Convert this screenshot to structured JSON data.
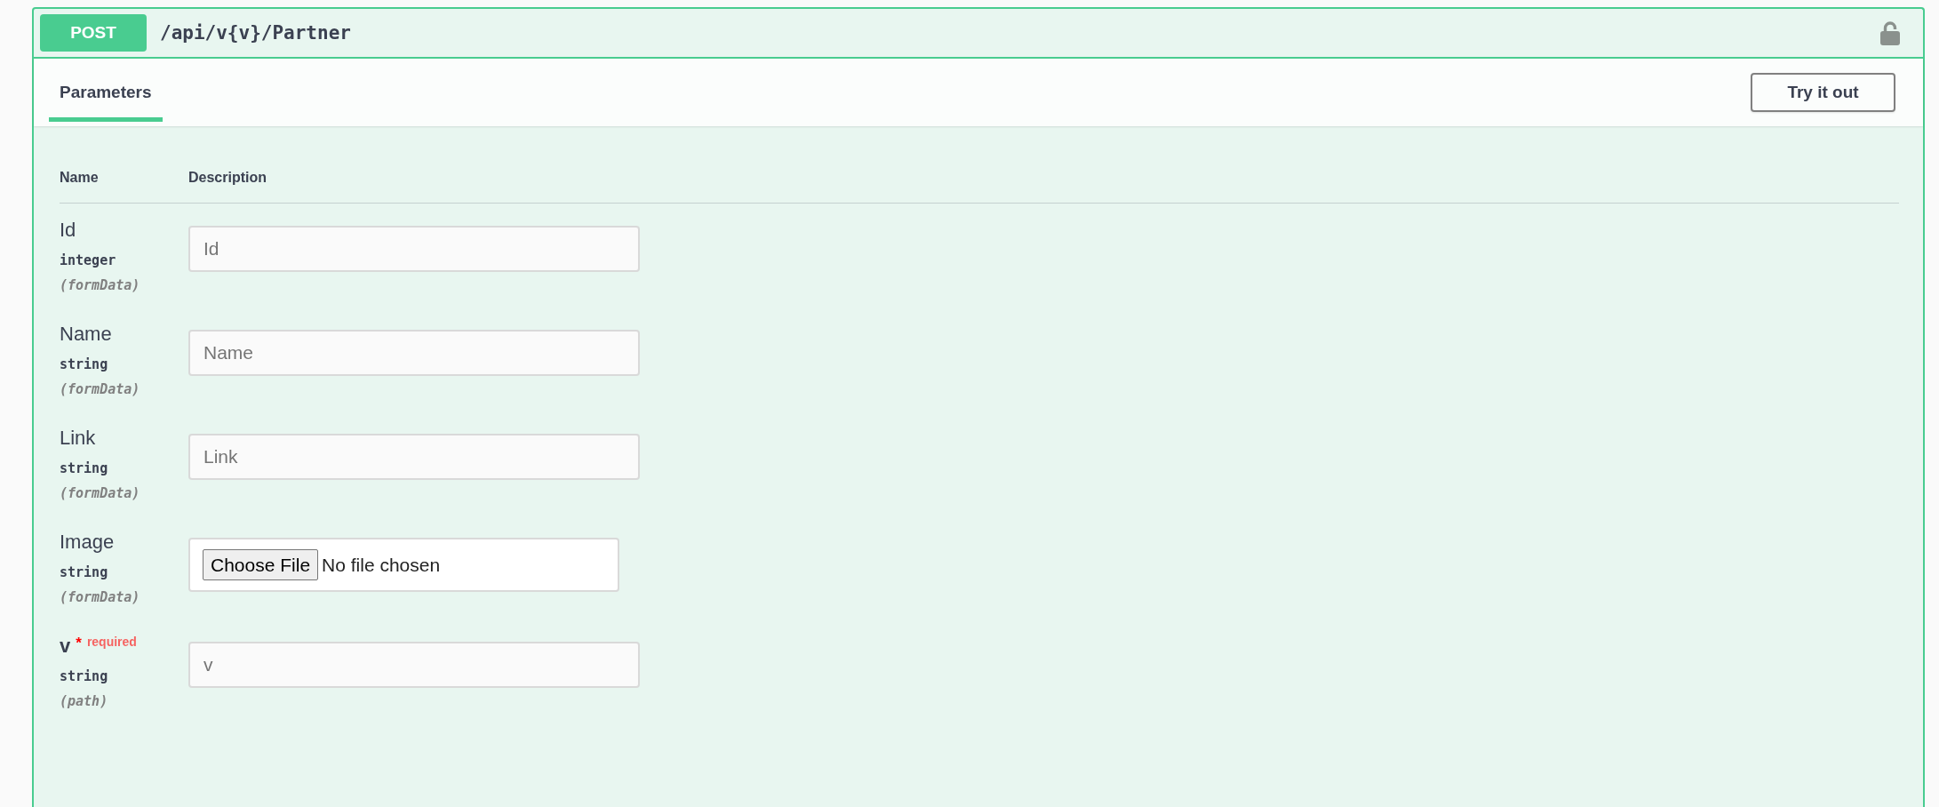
{
  "operation": {
    "method": "POST",
    "path": "/api/v{v}/Partner",
    "locked": false
  },
  "tabs": [
    {
      "label": "Parameters",
      "selected": true
    }
  ],
  "try_button": "Try it out",
  "table": {
    "columns": [
      "Name",
      "Description"
    ],
    "parameters": [
      {
        "name": "Id",
        "type": "integer",
        "in": "(formData)",
        "required": false,
        "kind": "text",
        "placeholder": "Id"
      },
      {
        "name": "Name",
        "type": "string",
        "in": "(formData)",
        "required": false,
        "kind": "text",
        "placeholder": "Name"
      },
      {
        "name": "Link",
        "type": "string",
        "in": "(formData)",
        "required": false,
        "kind": "text",
        "placeholder": "Link"
      },
      {
        "name": "Image",
        "type": "string",
        "in": "(formData)",
        "required": false,
        "kind": "file",
        "button": "Choose File",
        "status": "No file chosen"
      },
      {
        "name": "v",
        "star": "*",
        "required_label": "required",
        "type": "string",
        "in": "(path)",
        "required": true,
        "kind": "text",
        "placeholder": "v"
      }
    ]
  }
}
